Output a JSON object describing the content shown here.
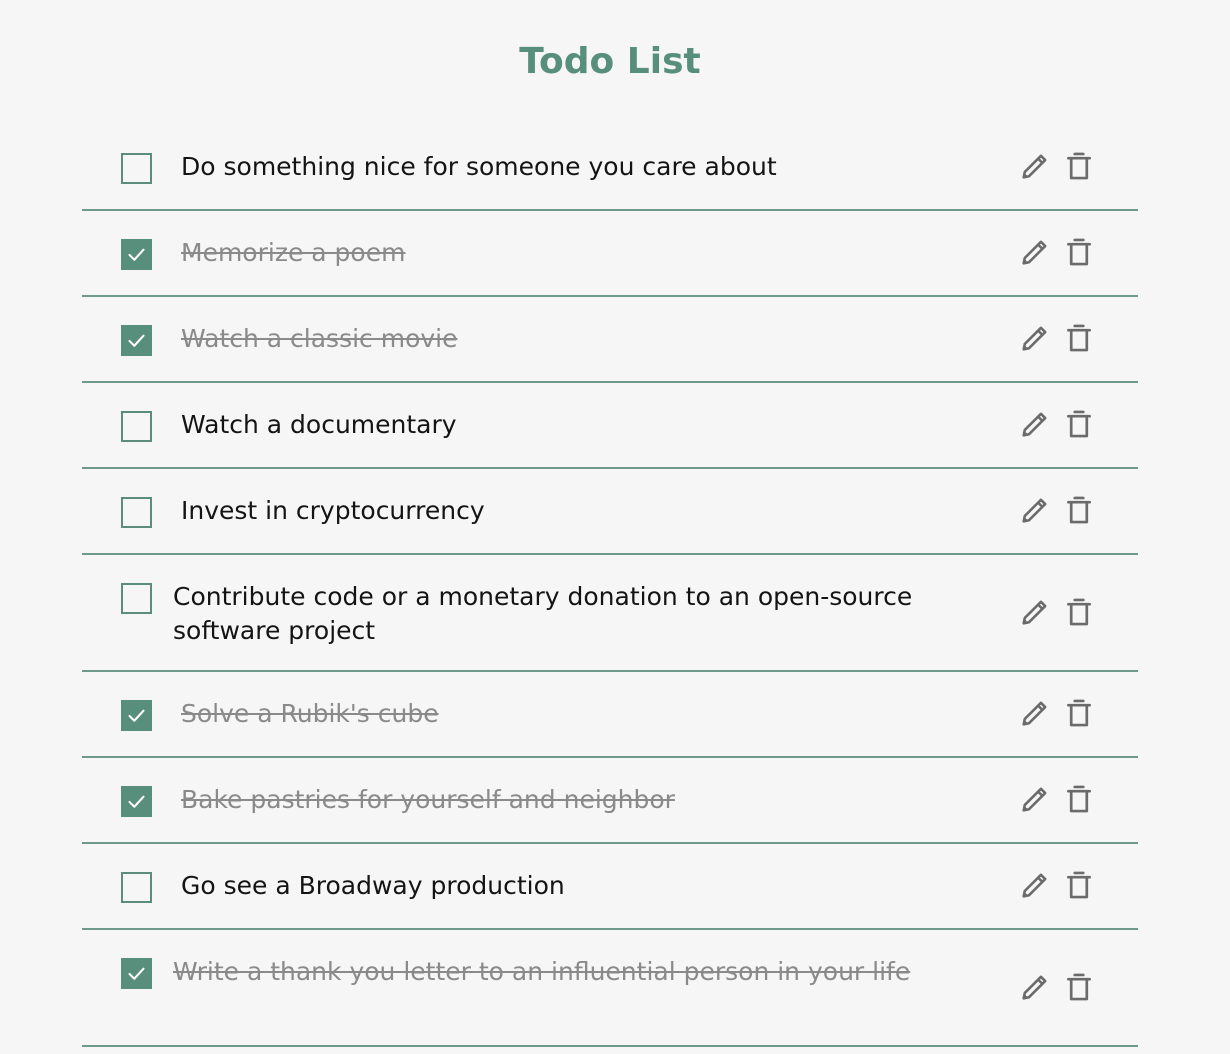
{
  "page": {
    "title": "Todo List"
  },
  "colors": {
    "accent": "#578e7c",
    "divider": "#6e9a8b",
    "text": "#141414",
    "done_text": "#8a8a8a",
    "icon": "#6b6b6b",
    "background": "#f6f6f6"
  },
  "actions": {
    "edit_icon": "pencil-icon",
    "delete_icon": "trash-icon"
  },
  "todos": [
    {
      "text": "Do something nice for someone you care about",
      "done": false
    },
    {
      "text": "Memorize a poem",
      "done": true
    },
    {
      "text": "Watch a classic movie",
      "done": true
    },
    {
      "text": "Watch a documentary",
      "done": false
    },
    {
      "text": "Invest in cryptocurrency",
      "done": false
    },
    {
      "text": "Contribute code or a monetary donation to an open-source software project",
      "done": false
    },
    {
      "text": "Solve a Rubik's cube",
      "done": true
    },
    {
      "text": "Bake pastries for yourself and neighbor",
      "done": true
    },
    {
      "text": "Go see a Broadway production",
      "done": false
    },
    {
      "text": "Write a thank you letter to an influential person in your life",
      "done": true
    }
  ]
}
